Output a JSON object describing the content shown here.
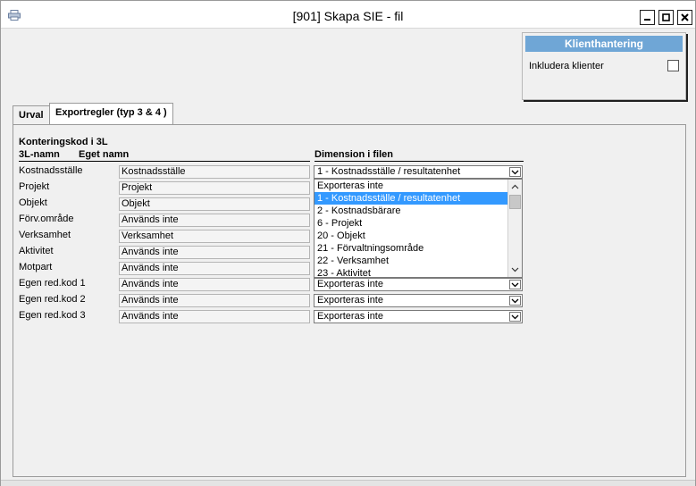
{
  "window": {
    "title": "[901]  Skapa SIE - fil",
    "app_icon": "printer-icon"
  },
  "client_panel": {
    "header": "Klienthantering",
    "include_label": "Inkludera klienter",
    "include_checked": false
  },
  "tabs": [
    {
      "label": "Urval",
      "active": false
    },
    {
      "label": "Exportregler (typ 3 & 4 )",
      "active": true
    }
  ],
  "section": {
    "title": "Konteringskod i 3L",
    "col_3l_name": "3L-namn",
    "col_own_name": "Eget namn",
    "col_dimension": "Dimension i filen"
  },
  "rows": [
    {
      "label": "Kostnadsställe",
      "own_name": "Kostnadsställe",
      "dimension": "1 - Kostnadsställe / resultatenhet"
    },
    {
      "label": "Projekt",
      "own_name": "Projekt",
      "dimension": ""
    },
    {
      "label": "Objekt",
      "own_name": "Objekt",
      "dimension": ""
    },
    {
      "label": "Förv.område",
      "own_name": "Används inte",
      "dimension": ""
    },
    {
      "label": "Verksamhet",
      "own_name": "Verksamhet",
      "dimension": ""
    },
    {
      "label": "Aktivitet",
      "own_name": "Används inte",
      "dimension": ""
    },
    {
      "label": "Motpart",
      "own_name": "Används inte",
      "dimension": ""
    },
    {
      "label": "Egen red.kod 1",
      "own_name": "Används inte",
      "dimension": "Exporteras inte"
    },
    {
      "label": "Egen red.kod 2",
      "own_name": "Används inte",
      "dimension": "Exporteras inte"
    },
    {
      "label": "Egen red.kod 3",
      "own_name": "Används inte",
      "dimension": "Exporteras inte"
    }
  ],
  "dropdown": {
    "selected_index": 1,
    "options": [
      "Exporteras inte",
      "1 - Kostnadsställe / resultatenhet",
      "2 - Kostnadsbärare",
      "6 - Projekt",
      "20 - Objekt",
      "21 - Förvaltningsområde",
      "22 - Verksamhet",
      "23 - Aktivitet"
    ]
  },
  "colors": {
    "client_header": "#6fa6d6",
    "selection": "#3399ff"
  }
}
